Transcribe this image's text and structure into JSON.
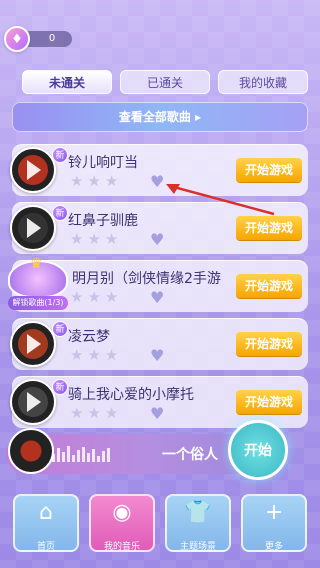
{
  "top": {
    "coins": "0"
  },
  "tabs": [
    {
      "label": "未通关",
      "active": true
    },
    {
      "label": "已通关",
      "active": false
    },
    {
      "label": "我的收藏",
      "active": false
    }
  ],
  "view_all_label": "查看全部歌曲 ▸",
  "songs": [
    {
      "title": "铃儿响叮当",
      "new_tag": "新",
      "button": "开始游戏",
      "cover": "#b2311f"
    },
    {
      "title": "红鼻子驯鹿",
      "new_tag": "新",
      "button": "开始游戏",
      "cover": "#333333"
    },
    {
      "title": "明月别（剑侠情缘2手游",
      "new_tag": "",
      "button": "开始游戏",
      "cover": "#8a5a2a"
    },
    {
      "title": "凌云梦",
      "new_tag": "新",
      "button": "开始游戏",
      "cover": "#a33a20"
    },
    {
      "title": "骑上我心爱的小摩托",
      "new_tag": "新",
      "button": "开始游戏",
      "cover": "#444444"
    }
  ],
  "unlock_badge": {
    "label": "解锁歌曲(1/3)"
  },
  "now_playing": {
    "singer": "一个俗人",
    "play_label": "开始"
  },
  "nav": [
    {
      "label": "首页",
      "icon": "home-icon",
      "glyph": "⌂",
      "active": false
    },
    {
      "label": "我的音乐",
      "icon": "music-disc-icon",
      "glyph": "◉",
      "active": true
    },
    {
      "label": "主题场景",
      "icon": "shirt-icon",
      "glyph": "👕",
      "active": false
    },
    {
      "label": "更多",
      "icon": "plus-icon",
      "glyph": "+",
      "active": false
    }
  ],
  "colors": {
    "start_button": "#f6a500",
    "accent": "#8a5be8",
    "annotation_arrow": "#d9302a"
  }
}
